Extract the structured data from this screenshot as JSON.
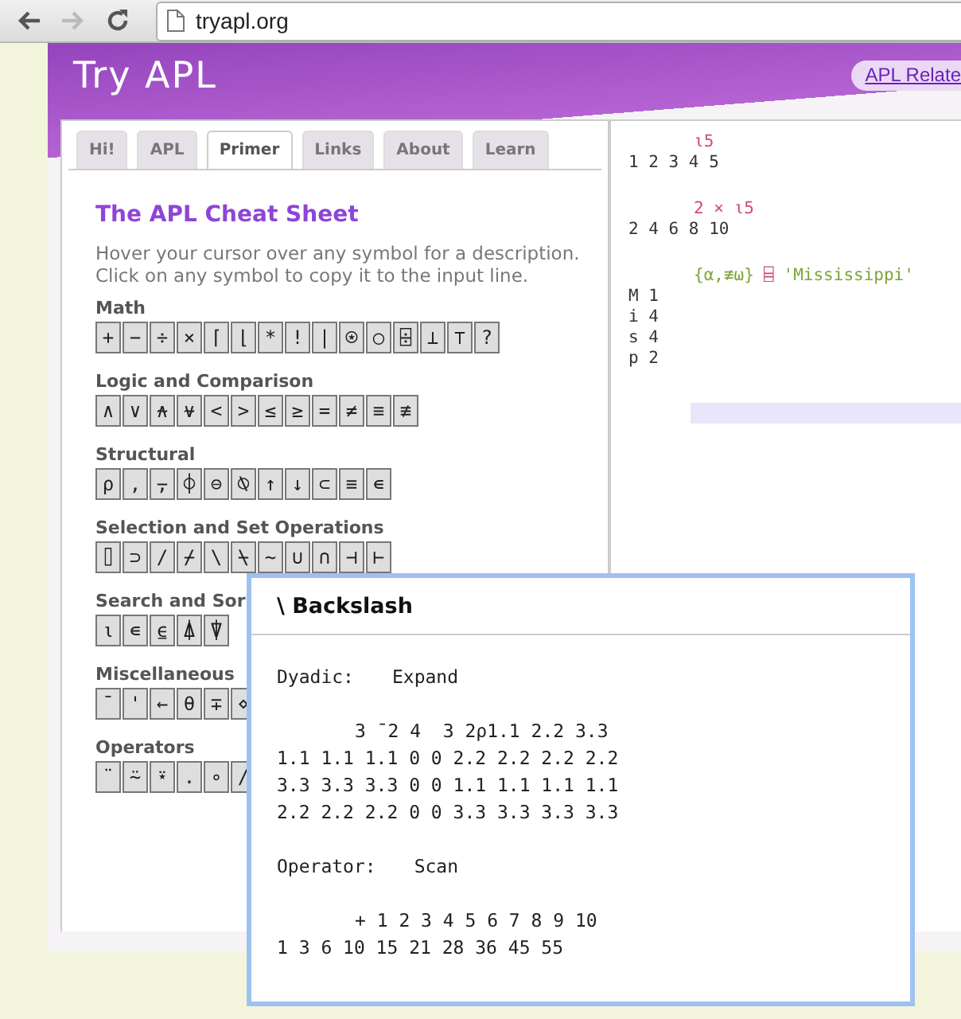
{
  "browser": {
    "nav": [
      {
        "kind": "back",
        "disabled": false
      },
      {
        "kind": "forward",
        "disabled": true
      },
      {
        "kind": "reload",
        "disabled": false
      }
    ],
    "address": "tryapl.org"
  },
  "header": {
    "logo": "Try APL",
    "link": "APL Relate"
  },
  "tabs": [
    {
      "label": "Hi!",
      "selected": false
    },
    {
      "label": "APL",
      "selected": false
    },
    {
      "label": "Primer",
      "selected": true
    },
    {
      "label": "Links",
      "selected": false
    },
    {
      "label": "About",
      "selected": false
    },
    {
      "label": "Learn",
      "selected": false
    }
  ],
  "cheat_sheet": {
    "title": "The APL Cheat Sheet",
    "description": [
      "Hover your cursor over any symbol for a description.",
      "Click on any symbol to copy it to the input line."
    ],
    "groups": [
      {
        "heading": "Math",
        "symbols": [
          "+",
          "−",
          "÷",
          "×",
          "⌈",
          "⌊",
          "*",
          "!",
          "|",
          "⍟",
          "○",
          "⌹",
          "⊥",
          "⊤",
          "?"
        ]
      },
      {
        "heading": "Logic and Comparison",
        "symbols": [
          "∧",
          "∨",
          "⍲",
          "⍱",
          "<",
          ">",
          "≤",
          "≥",
          "=",
          "≠",
          "≡",
          "≢"
        ]
      },
      {
        "heading": "Structural",
        "symbols": [
          "⍴",
          ",",
          "⍪",
          "⌽",
          "⊖",
          "⍉",
          "↑",
          "↓",
          "⊂",
          "≡",
          "∊"
        ]
      },
      {
        "heading": "Selection and Set Operations",
        "symbols": [
          "⌷",
          "⊃",
          "/",
          "⌿",
          "\\",
          "⍀",
          "~",
          "∪",
          "∩",
          "⊣",
          "⊢"
        ]
      },
      {
        "heading": "Search and Sor",
        "symbols": [
          "⍳",
          "∊",
          "⍷",
          "⍋",
          "⍒"
        ]
      },
      {
        "heading": "Miscellaneous",
        "symbols": [
          "¯",
          "'",
          "←",
          "θ",
          "∓",
          "⋄"
        ]
      },
      {
        "heading": "Operators",
        "symbols": [
          "¨",
          "⍨",
          "⍣",
          ".",
          "∘",
          "/"
        ]
      }
    ]
  },
  "session": {
    "lines": [
      {
        "kind": "input",
        "tokens": [
          {
            "text": "⍳5",
            "color": "#d04a7a"
          }
        ]
      },
      {
        "kind": "output",
        "text": "1 2 3 4 5"
      },
      {
        "kind": "input",
        "tokens": [
          {
            "text": "2 × ⍳5",
            "color": "#d04a7a"
          }
        ]
      },
      {
        "kind": "output",
        "text": "2 4 6 8 10"
      },
      {
        "kind": "input",
        "tokens": [
          {
            "text": "{⍺,≢⍵}",
            "color": "#7aa536"
          },
          {
            "text": "⌸",
            "color": "#d04a7a"
          },
          {
            "text": "'Mississippi'",
            "color": "#7aa536"
          }
        ]
      },
      {
        "kind": "output",
        "text": "M 1"
      },
      {
        "kind": "output",
        "text": "i 4"
      },
      {
        "kind": "output",
        "text": "s 4"
      },
      {
        "kind": "output",
        "text": "p 2"
      }
    ]
  },
  "popup": {
    "title": "\\ Backslash",
    "sections": [
      {
        "label": "Dyadic:",
        "name": "Expand",
        "lines": [
          {
            "kind": "input",
            "text": "3 ¯2 4  3 2⍴1.1 2.2 3.3"
          },
          {
            "kind": "output",
            "text": "1.1 1.1 1.1 0 0 2.2 2.2 2.2 2.2"
          },
          {
            "kind": "output",
            "text": "3.3 3.3 3.3 0 0 1.1 1.1 1.1 1.1"
          },
          {
            "kind": "output",
            "text": "2.2 2.2 2.2 0 0 3.3 3.3 3.3 3.3"
          }
        ]
      },
      {
        "label": "Operator:",
        "name": "Scan",
        "lines": [
          {
            "kind": "input",
            "text": "+ 1 2 3 4 5 6 7 8 9 10"
          },
          {
            "kind": "output",
            "text": "1 3 6 10 15 21 28 36 45 55"
          }
        ]
      }
    ]
  }
}
